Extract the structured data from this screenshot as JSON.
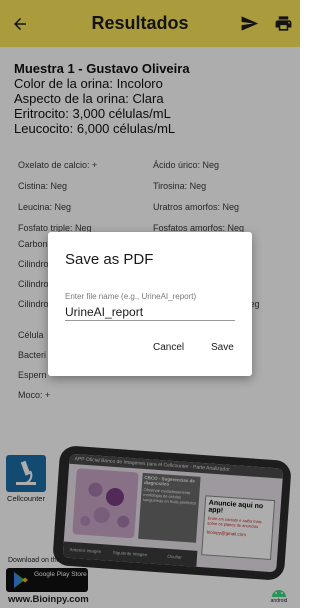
{
  "appbar": {
    "title": "Resultados",
    "back_icon": "arrow-left-icon",
    "send_icon": "send-icon",
    "print_icon": "print-icon",
    "color": "#fbe65a"
  },
  "sample": {
    "title": "Muestra 1 - Gustavo Oliveira",
    "lines": [
      "Color de la orina: Incoloro",
      "Aspecto de la orina: Clara",
      "Eritrocito: 3,000 células/mL",
      "Leucocito: 6,000 células/mL"
    ]
  },
  "findings": {
    "left": [
      "Oxelato de calcio: +",
      "Cistina: Neg",
      "Leucina: Neg",
      "Fosfato triple: Neg",
      "Carbon",
      "Cilindro",
      "Cilindro",
      "Cilindro",
      "Célula",
      "Bacteri",
      "Espern",
      "Moco: +"
    ],
    "right": [
      "Ácido úrico: Neg",
      "Tirosina: Neg",
      "Uratros amorfos: Neg",
      "Fosfatos amorfos: Neg",
      "",
      "",
      "Neg"
    ]
  },
  "ad": {
    "cellcounter_label": "Cellcounter",
    "store_label": "Download on the",
    "store_name": "Google Play Store",
    "website": "www.Bioinpy.com",
    "phone_header": "APP Oficial Banco de Imagenes para el Cellcounter - Parte Analizador",
    "phone_desc_title": "CBCO - Sugerencias de diagnostico",
    "phone_desc_text": "Observar cuidadosamente morfologia de celulas sanguineas en frotis periferico",
    "phone_ad_title": "Anuncie aqui no app!",
    "phone_ad_text": "Entre em contato e saiba mais sobre os planos de anuncios",
    "phone_ad_email": "bioinpy@gmail.com",
    "phone_tabs": [
      "Anterior imagen",
      "Siguiente imagen",
      "Ocultar"
    ],
    "android_label": "android"
  },
  "dialog": {
    "title": "Save as PDF",
    "field_label": "Enter file name (e.g., UrineAI_report)",
    "field_value": "UrineAI_report",
    "cancel_label": "Cancel",
    "save_label": "Save"
  }
}
